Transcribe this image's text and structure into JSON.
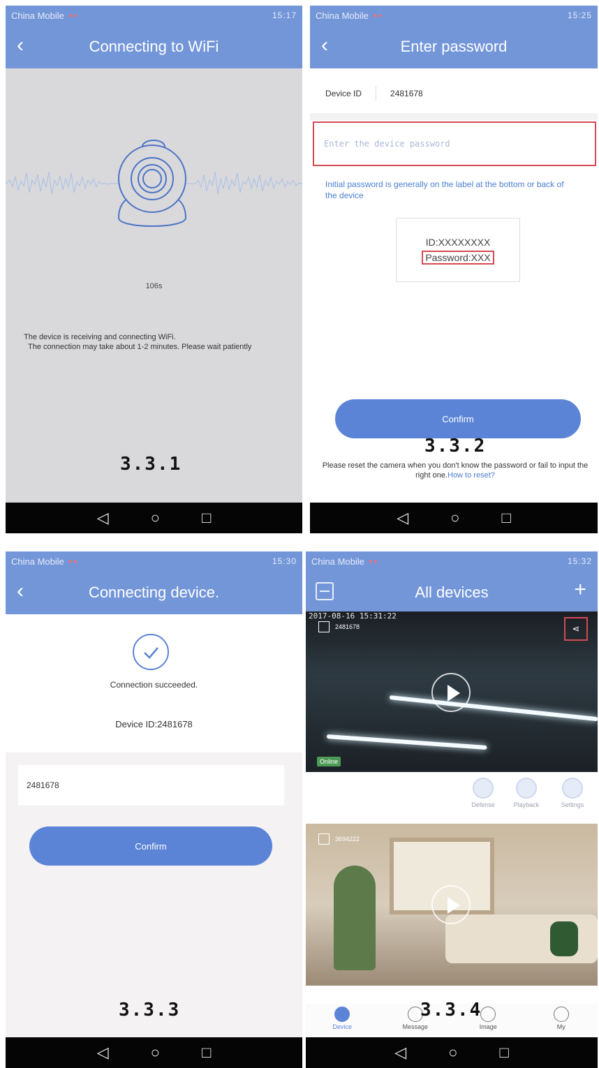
{
  "colors": {
    "header": "#7396d9",
    "accent": "#5b84d6",
    "highlight_box": "#d34a52",
    "link": "#4a7fd1"
  },
  "panel1": {
    "status": {
      "carrier": "China Mobile",
      "time": "15:17"
    },
    "title": "Connecting to WiFi",
    "timer": "106s",
    "message_line1": "The device is receiving and connecting WiFi.",
    "message_line2": "The connection may take about 1-2 minutes. Please wait patiently",
    "step": "3.3.1"
  },
  "panel2": {
    "status": {
      "carrier": "China Mobile",
      "time": "15:25"
    },
    "title": "Enter password",
    "device_id_label": "Device ID",
    "device_id_value": "2481678",
    "password_placeholder": "Enter the device password",
    "hint": "Initial password is generally on the label at the bottom or back of the device",
    "label_id": "ID:XXXXXXXX",
    "label_password": "Password:XXX",
    "confirm": "Confirm",
    "step": "3.3.2",
    "reset_note": "Please reset the camera when you don't know the password or fail to input the right one.",
    "reset_link": "How to reset?"
  },
  "panel3": {
    "status": {
      "carrier": "China Mobile",
      "time": "15:30"
    },
    "title": "Connecting device.",
    "success": "Connection succeeded.",
    "device_id": "Device ID:2481678",
    "input_value": "2481678",
    "confirm": "Confirm",
    "step": "3.3.3"
  },
  "panel4": {
    "status": {
      "carrier": "China Mobile",
      "time": "15:32"
    },
    "title": "All devices",
    "add": "+",
    "feed1_timestamp": "2017-08-16 15:31:22",
    "feed1_name": "2481678",
    "feed1_status": "Online",
    "feed2_name": "3694222",
    "actions": [
      "Defense",
      "Playback",
      "Settings"
    ],
    "tabs": [
      "Device",
      "Message",
      "Image",
      "My"
    ],
    "step": "3.3.4"
  },
  "icons": {
    "back": "back-arrow-icon",
    "nav": [
      "nav-back-icon",
      "nav-home-icon",
      "nav-recent-icon"
    ]
  }
}
